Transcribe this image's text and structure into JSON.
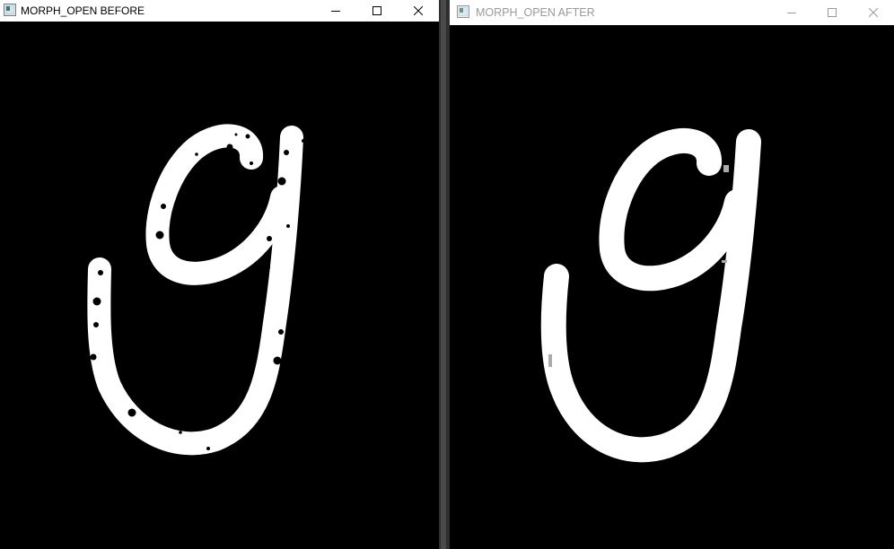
{
  "windows": {
    "before": {
      "title": "MORPH_OPEN BEFORE",
      "controls": [
        "minimize-icon",
        "maximize-icon",
        "close-icon"
      ]
    },
    "after": {
      "title": "MORPH_OPEN AFTER",
      "controls": [
        "minimize-icon",
        "maximize-icon",
        "close-icon"
      ]
    }
  },
  "colors": {
    "background": "#000000",
    "stroke": "#ffffff",
    "title_active": "#000000",
    "title_inactive": "#9a9a9a"
  }
}
